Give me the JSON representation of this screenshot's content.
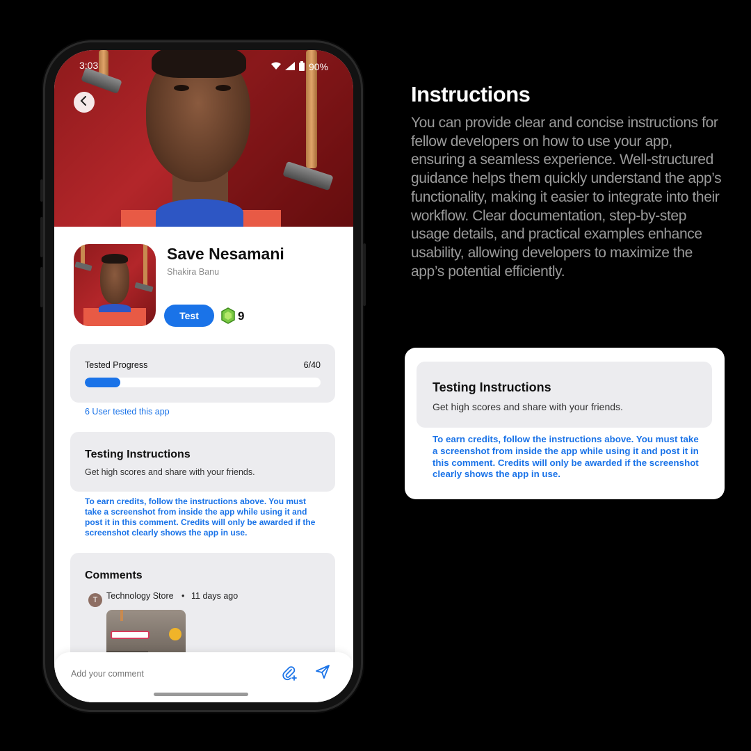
{
  "status_bar": {
    "time": "3:03",
    "battery": "90%"
  },
  "app": {
    "title": "Save Nesamani",
    "author": "Shakira Banu",
    "test_label": "Test",
    "credits": "9"
  },
  "progress": {
    "label": "Tested Progress",
    "count": "6/40",
    "fraction": 0.15,
    "tested_link": "6 User tested this app"
  },
  "instructions": {
    "title": "Testing Instructions",
    "body": "Get high scores and share with your friends.",
    "note": "To earn credits, follow the instructions above. You must take a screenshot from inside the app while using it and post it in this comment. Credits will only be awarded if the screenshot clearly shows the app in use."
  },
  "comments": {
    "title": "Comments",
    "items": [
      {
        "avatar_letter": "T",
        "author": "Technology Store",
        "separator": "•",
        "time": "11 days ago"
      }
    ]
  },
  "comment_bar": {
    "placeholder": "Add your comment"
  },
  "side_panel": {
    "heading": "Instructions",
    "body": "You can provide clear and concise instructions for fellow developers on how to use your app, ensuring a seamless experience. Well-structured guidance helps them quickly understand the app’s functionality, making it easier to integrate into their workflow. Clear documentation, step-by-step usage details, and practical examples enhance usability, allowing developers to maximize the app’s potential efficiently."
  },
  "icons": {
    "back": "chevron-left-icon",
    "credits": "gem-icon",
    "attach": "attachment-icon",
    "send": "send-icon"
  },
  "colors": {
    "accent": "#1a73e8",
    "background": "#000000",
    "card": "#ececef",
    "hero_red": "#b3262a"
  }
}
